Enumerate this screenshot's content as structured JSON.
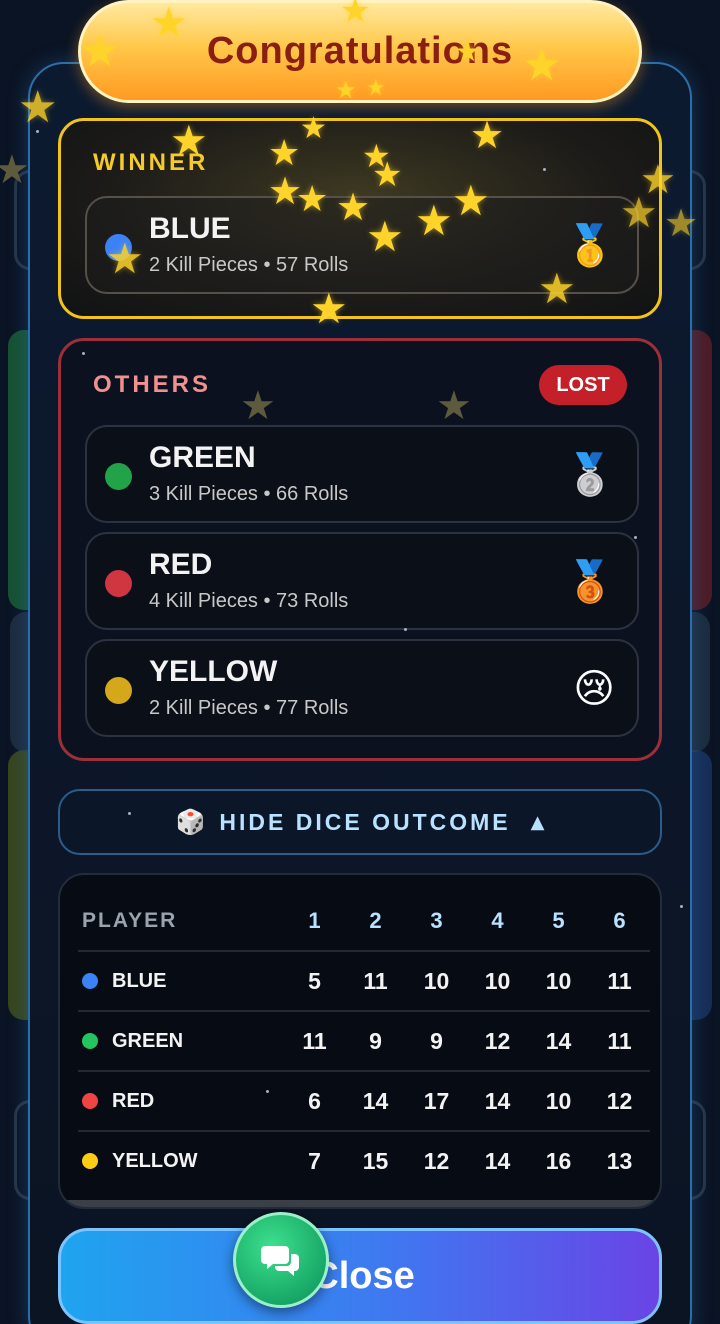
{
  "banner": {
    "title": "Congratulations"
  },
  "winner": {
    "heading": "WINNER",
    "player": {
      "name": "BLUE",
      "stats": "2 Kill Pieces • 57 Rolls",
      "color": "#3b82f6",
      "medal": "🥇",
      "medal_icon": "gold-medal-icon"
    }
  },
  "others": {
    "heading": "OTHERS",
    "badge": "LOST",
    "players": [
      {
        "name": "GREEN",
        "stats": "3 Kill Pieces • 66 Rolls",
        "color": "#22a34a",
        "medal": "🥈",
        "medal_icon": "silver-medal-icon"
      },
      {
        "name": "RED",
        "stats": "4 Kill Pieces • 73 Rolls",
        "color": "#d0363f",
        "medal": "🥉",
        "medal_icon": "bronze-medal-icon"
      },
      {
        "name": "YELLOW",
        "stats": "2 Kill Pieces • 77 Rolls",
        "color": "#d4a81a",
        "medal": "😢",
        "medal_icon": "crying-face-icon"
      }
    ]
  },
  "dice_toggle": {
    "icon": "🎲",
    "label": "HIDE DICE OUTCOME",
    "caret": "▲"
  },
  "dice_table": {
    "header": [
      "PLAYER",
      "1",
      "2",
      "3",
      "4",
      "5",
      "6"
    ],
    "rows": [
      {
        "player": "BLUE",
        "color": "#3b82f6",
        "values": [
          "5",
          "11",
          "10",
          "10",
          "10",
          "11"
        ]
      },
      {
        "player": "GREEN",
        "color": "#22c55e",
        "values": [
          "11",
          "9",
          "9",
          "12",
          "14",
          "11"
        ]
      },
      {
        "player": "RED",
        "color": "#ef4444",
        "values": [
          "6",
          "14",
          "17",
          "14",
          "10",
          "12"
        ]
      },
      {
        "player": "YELLOW",
        "color": "#facc15",
        "values": [
          "7",
          "15",
          "12",
          "14",
          "16",
          "13"
        ]
      }
    ]
  },
  "close_button": {
    "label": "Close"
  },
  "chat_button": {
    "icon": "chat-bubbles-icon"
  }
}
